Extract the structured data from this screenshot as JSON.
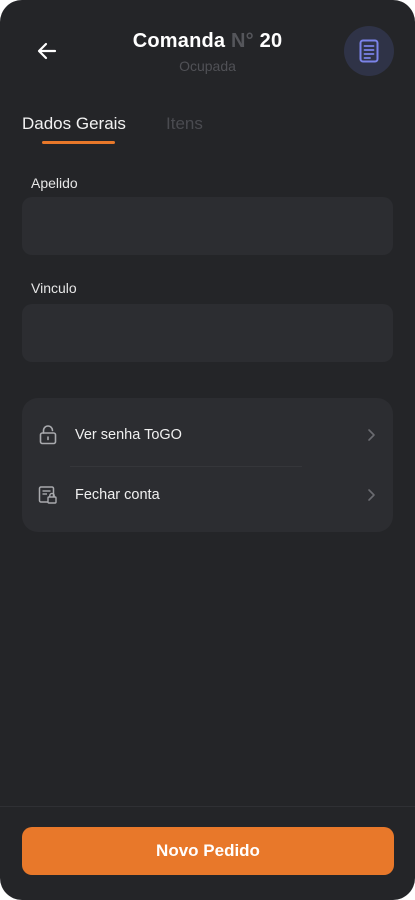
{
  "header": {
    "title_main": "Comanda",
    "title_number_sign": "N°",
    "title_number": "20",
    "subtitle": "Ocupada",
    "back_icon": "arrow-left-icon",
    "doc_icon": "document-icon"
  },
  "tabs": [
    {
      "label": "Dados Gerais",
      "active": true
    },
    {
      "label": "Itens",
      "active": false
    }
  ],
  "form": {
    "apelido": {
      "label": "Apelido",
      "value": ""
    },
    "vinculo": {
      "label": "Vinculo",
      "value": ""
    }
  },
  "actions": [
    {
      "label": "Ver senha ToGO",
      "icon": "lock-icon"
    },
    {
      "label": "Fechar conta",
      "icon": "receipt-lock-icon"
    }
  ],
  "footer": {
    "primary_label": "Novo Pedido"
  },
  "colors": {
    "background": "#242528",
    "surface": "#2c2d31",
    "accent": "#e8782a",
    "doc_button": "#2f3347",
    "doc_icon": "#7b83e8"
  }
}
